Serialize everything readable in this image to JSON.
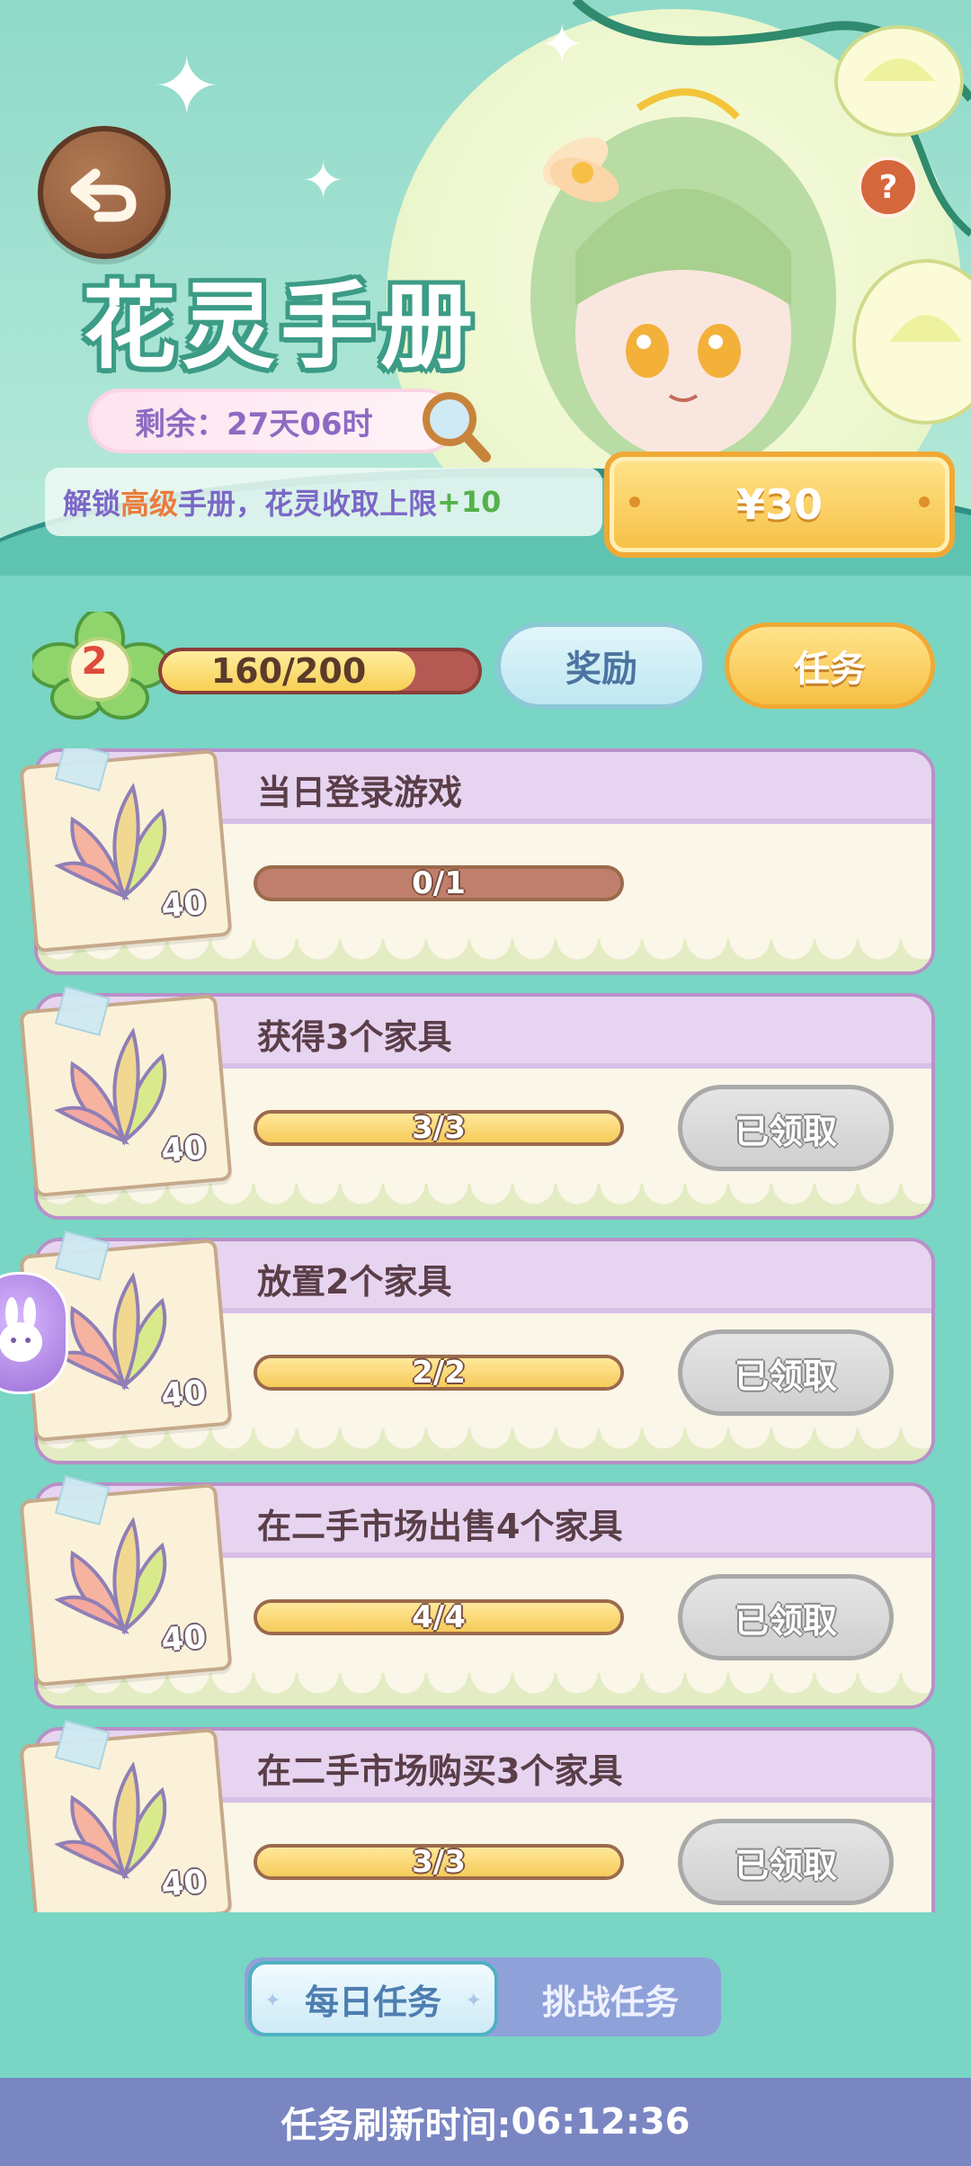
{
  "header": {
    "title": "花灵手册",
    "remaining_prefix": "剩余：",
    "remaining_time": "27天06时",
    "unlock": {
      "text1": "解锁",
      "highlight": "高级",
      "text2": "手册，花灵收取上限",
      "bonus": "+10"
    },
    "price": "¥30",
    "help": "?"
  },
  "progress": {
    "level": "2",
    "current": 160,
    "max": 200,
    "text": "160/200"
  },
  "tabs": {
    "rewards": "奖励",
    "tasks": "任务"
  },
  "tasks": [
    {
      "title": "当日登录游戏",
      "progress": "0/1",
      "ratio": 0,
      "reward": "40",
      "status": ""
    },
    {
      "title": "获得3个家具",
      "progress": "3/3",
      "ratio": 1,
      "reward": "40",
      "status": "已领取"
    },
    {
      "title": "放置2个家具",
      "progress": "2/2",
      "ratio": 1,
      "reward": "40",
      "status": "已领取"
    },
    {
      "title": "在二手市场出售4个家具",
      "progress": "4/4",
      "ratio": 1,
      "reward": "40",
      "status": "已领取"
    },
    {
      "title": "在二手市场购买3个家具",
      "progress": "3/3",
      "ratio": 1,
      "reward": "40",
      "status": "已领取"
    }
  ],
  "bottom_tabs": {
    "daily": "每日任务",
    "challenge": "挑战任务"
  },
  "footer": {
    "label": "任务刷新时间: ",
    "time": "06:12:36"
  },
  "colors": {
    "accent_gold": "#f6c044",
    "card_border": "#b890c8",
    "footer_bg": "#7a86c2"
  }
}
